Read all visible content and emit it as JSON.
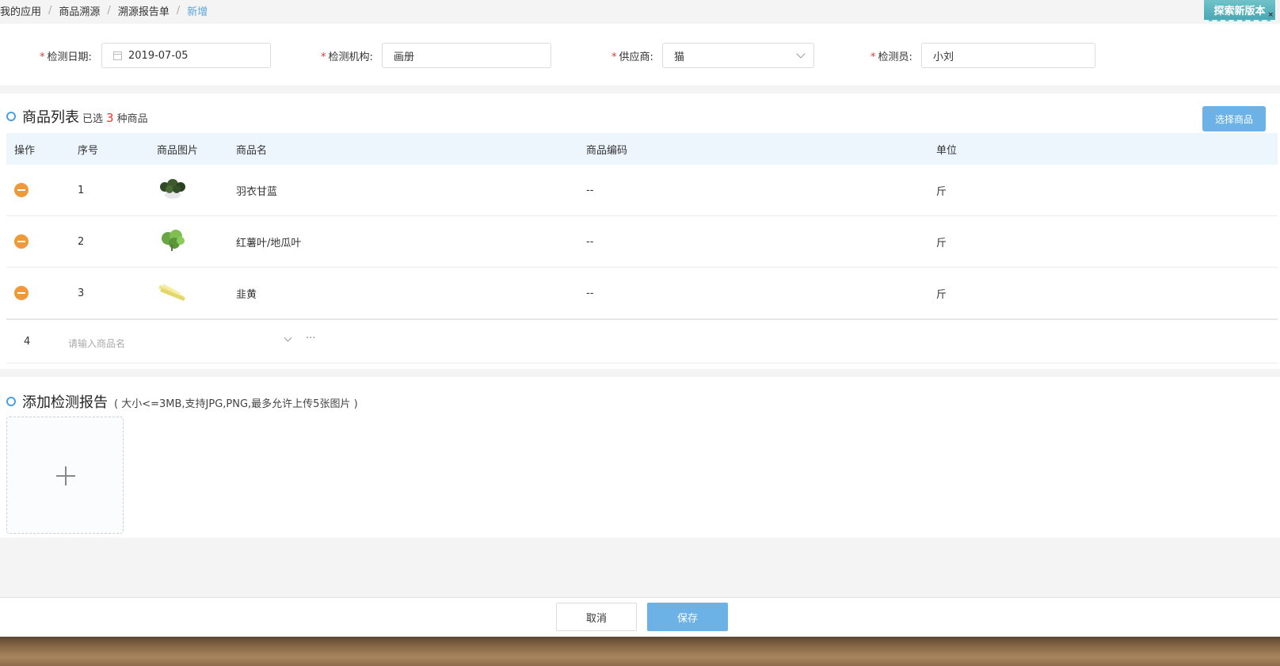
{
  "breadcrumb": {
    "items": [
      "我的应用",
      "商品溯源",
      "溯源报告单"
    ],
    "current": "新增",
    "separator": "/"
  },
  "badge": {
    "label": "探索新版本",
    "close": "×"
  },
  "form": {
    "required_mark": "*",
    "date": {
      "label": "检测日期:",
      "value": "2019-07-05"
    },
    "agency": {
      "label": "检测机构:",
      "value": "画册"
    },
    "supplier": {
      "label": "供应商:",
      "value": "猫"
    },
    "inspector": {
      "label": "检测员:",
      "value": "小刘"
    }
  },
  "goods": {
    "title": "商品列表",
    "selected_prefix": "已选",
    "selected_count": "3",
    "selected_suffix": "种商品",
    "select_button": "选择商品",
    "columns": [
      "操作",
      "序号",
      "商品图片",
      "商品名",
      "商品编码",
      "单位"
    ],
    "rows": [
      {
        "no": "1",
        "name": "羽衣甘蓝",
        "code": "--",
        "unit": "斤",
        "image": "kale-image"
      },
      {
        "no": "2",
        "name": "红薯叶/地瓜叶",
        "code": "--",
        "unit": "斤",
        "image": "sweet-potato-leaf-image"
      },
      {
        "no": "3",
        "name": "韭黄",
        "code": "--",
        "unit": "斤",
        "image": "yellow-chive-image"
      }
    ],
    "new_row": {
      "no": "4",
      "placeholder": "请输入商品名",
      "more": "···"
    }
  },
  "report": {
    "title": "添加检测报告",
    "hint": "( 大小<=3MB,支持JPG,PNG,最多允许上传5张图片 )"
  },
  "footer": {
    "cancel": "取消",
    "save": "保存"
  },
  "colors": {
    "accent": "#6cb2e6",
    "required": "#e33333",
    "remove": "#ee9a3a",
    "breadcrumb_current": "#5aa6e0"
  }
}
